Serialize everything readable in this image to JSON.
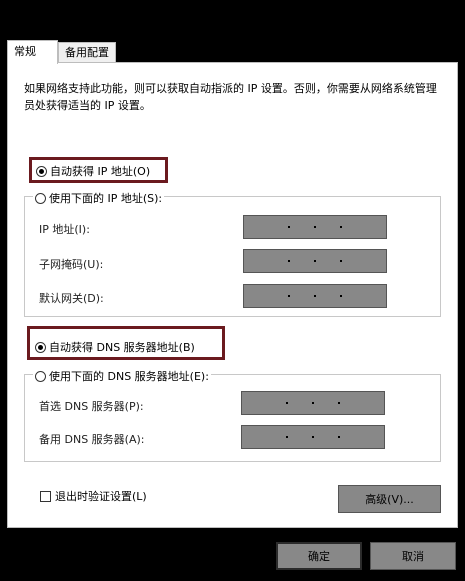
{
  "tabs": [
    {
      "label": "常规",
      "active": true
    },
    {
      "label": "备用配置",
      "active": false
    }
  ],
  "description": "如果网络支持此功能，则可以获取自动指派的 IP 设置。否则，你需要从网络系统管理员处获得适当的 IP 设置。",
  "ip": {
    "auto_label": "自动获得 IP 地址(O)",
    "manual_label": "使用下面的 IP 地址(S):",
    "fields": {
      "address_label": "IP 地址(I):",
      "subnet_label": "子网掩码(U):",
      "gateway_label": "默认网关(D):"
    }
  },
  "dns": {
    "auto_label": "自动获得 DNS 服务器地址(B)",
    "manual_label": "使用下面的 DNS 服务器地址(E):",
    "fields": {
      "preferred_label": "首选 DNS 服务器(P):",
      "alternate_label": "备用 DNS 服务器(A):"
    }
  },
  "validate_label": "退出时验证设置(L)",
  "advanced_label": "高级(V)...",
  "ok_label": "确定",
  "cancel_label": "取消",
  "colors": {
    "highlight_border": "#6b1a1f",
    "disabled_field": "#888888",
    "background": "#000000"
  }
}
